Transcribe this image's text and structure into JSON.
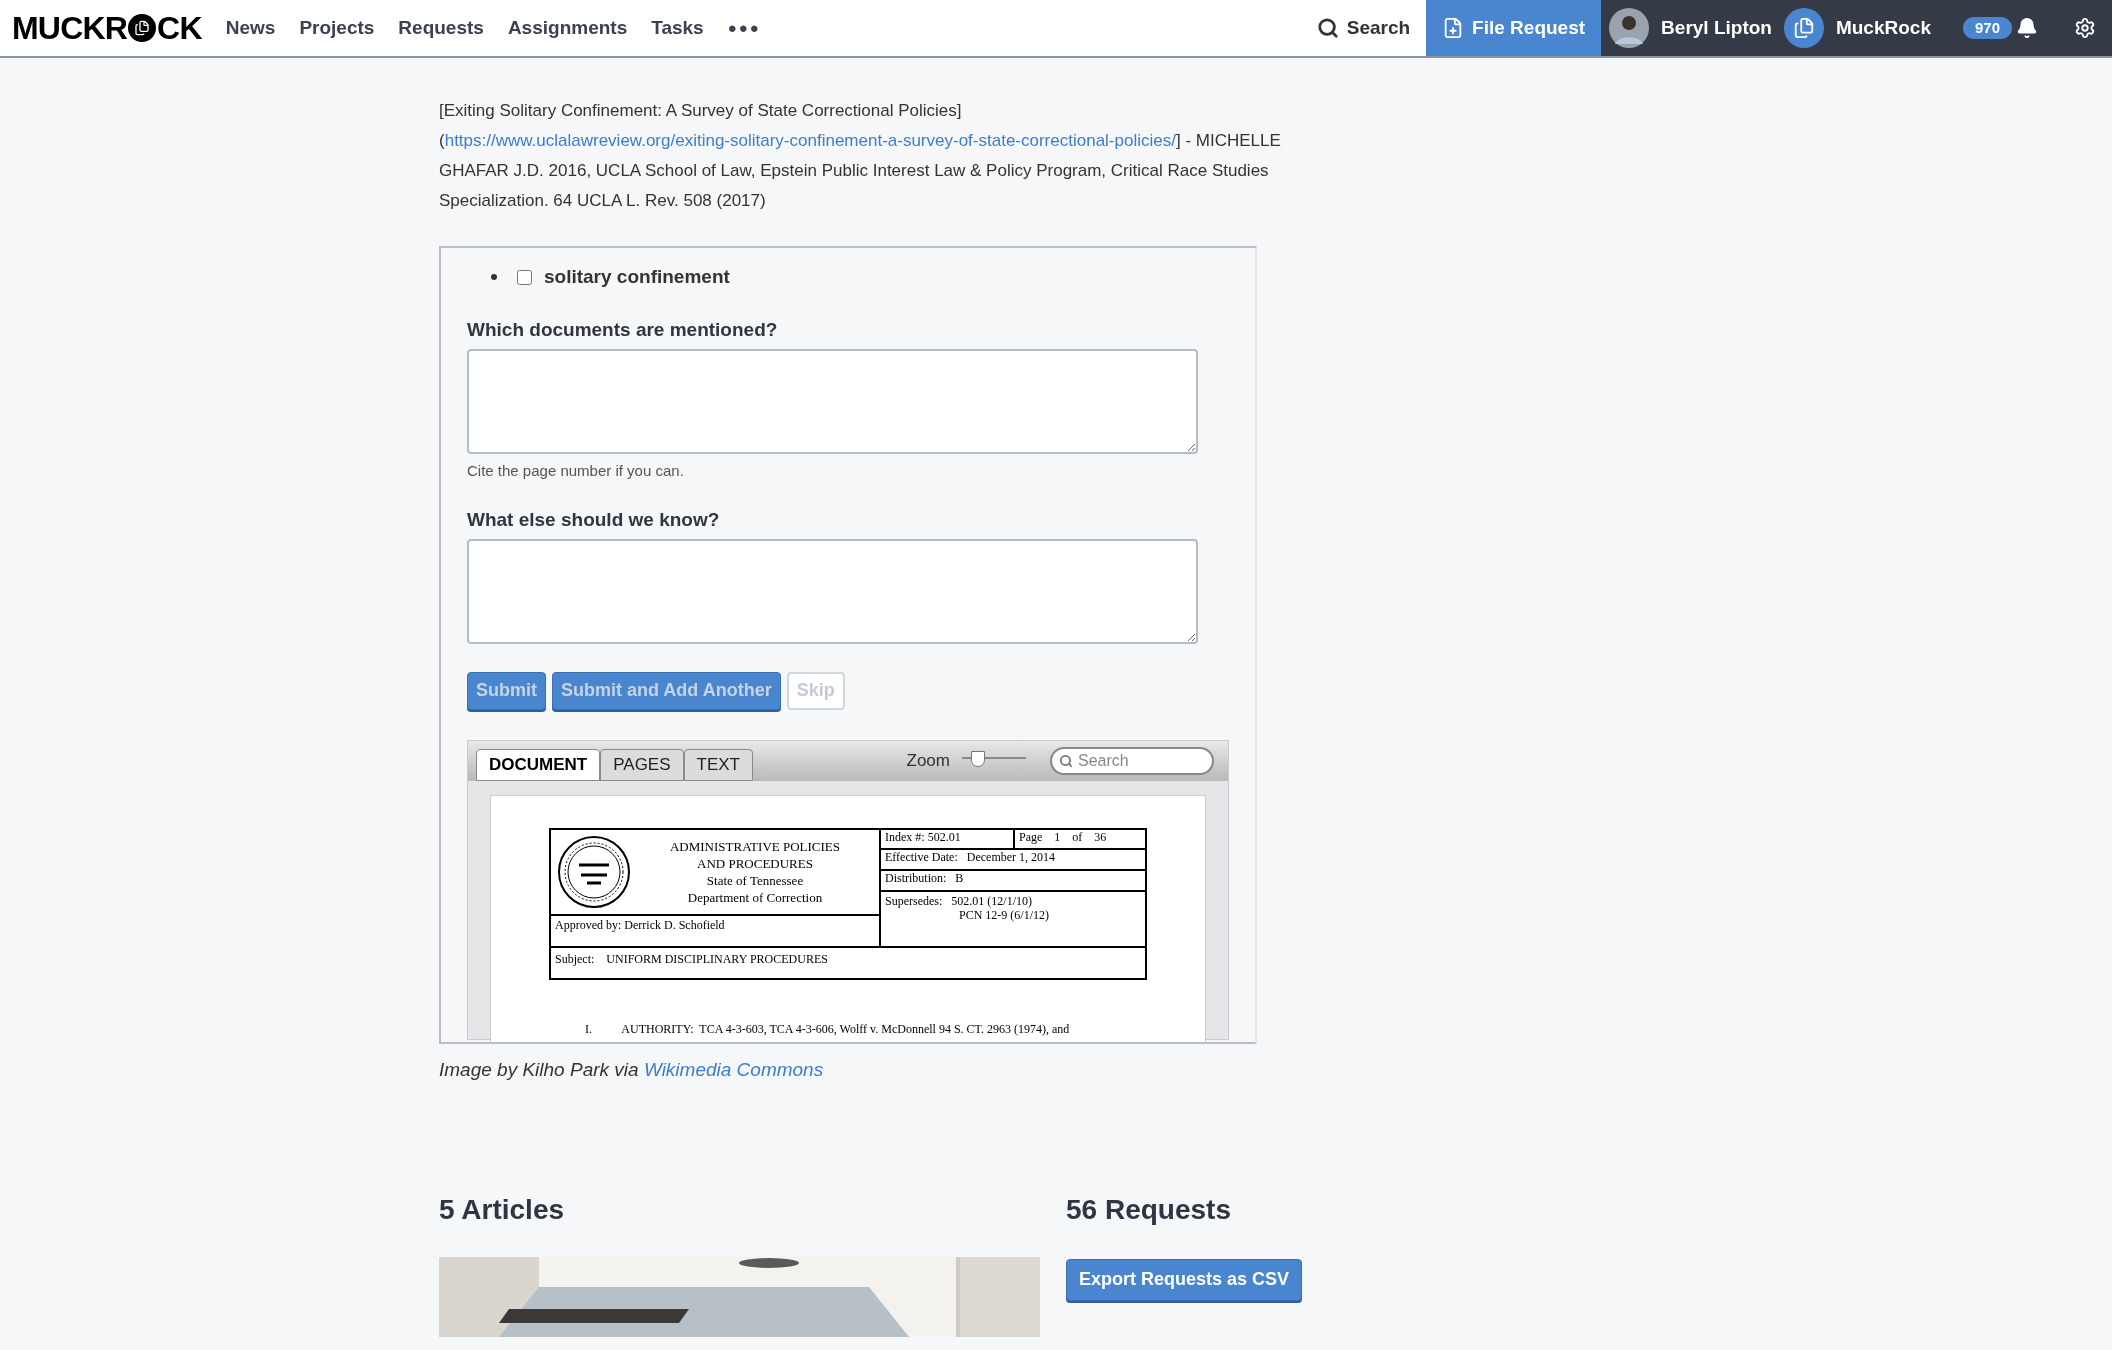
{
  "nav": {
    "logo_before": "MUCKR",
    "logo_after": "CK",
    "links": [
      "News",
      "Projects",
      "Requests",
      "Assignments",
      "Tasks"
    ],
    "more": "●●●",
    "search": "Search",
    "file_request": "File Request",
    "user": "Beryl Lipton",
    "org": "MuckRock",
    "notifications": "970"
  },
  "citation": {
    "before": "[Exiting Solitary Confinement: A Survey of State Correctional Policies](",
    "link": "https://www.uclalawreview.org/exiting-solitary-confinement-a-survey-of-state-correctional-policies/",
    "after": "] - MICHELLE GHAFAR J.D. 2016, UCLA School of Law, Epstein Public Interest Law & Policy Program, Critical Race Studies Specialization. 64 UCLA L. Rev. 508 (2017)"
  },
  "form": {
    "options": [
      {
        "label": "solitary confinement",
        "checked": false
      }
    ],
    "fields": [
      {
        "label": "Which documents are mentioned?",
        "help": "Cite the page number if you can."
      },
      {
        "label": "What else should we know?"
      }
    ],
    "buttons": [
      {
        "label": "Submit",
        "kind": "primary",
        "disabled": true
      },
      {
        "label": "Submit and Add Another",
        "kind": "primary",
        "disabled": true
      },
      {
        "label": "Skip",
        "kind": "plain",
        "disabled": true
      }
    ]
  },
  "viewer": {
    "tabs": [
      {
        "label": "DOCUMENT",
        "selected": true
      },
      {
        "label": "PAGES",
        "selected": false
      },
      {
        "label": "TEXT",
        "selected": false
      }
    ],
    "zoom_label": "Zoom",
    "zoom": {
      "level": 0.25
    },
    "search": {
      "placeholder": "Search"
    },
    "document": {
      "title_lines": [
        "ADMINISTRATIVE POLICIES",
        "AND PROCEDURES",
        "State of Tennessee",
        "Department of Correction"
      ],
      "index": "Index #: 502.01",
      "page": "Page    1    of    36",
      "effective": "Effective Date:   December 1, 2014",
      "distribution": "Distribution:   B",
      "supersedes": "Supersedes:   502.01 (12/1/10)",
      "supersedes_2": "PCN 12-9 (6/1/12)",
      "approved": "Approved by:   Derrick D. Schofield",
      "subject": "Subject:    UNIFORM DISCIPLINARY PROCEDURES",
      "first_line": "I.          AUTHORITY:  TCA 4-3-603, TCA 4-3-606, Wolff v. McDonnell 94 S. CT. 2963 (1974), and"
    }
  },
  "caption": {
    "text": "Image by Kilho Park via ",
    "link": "Wikimedia Commons"
  },
  "articles": {
    "heading": "5 Articles"
  },
  "requests": {
    "heading": "56 Requests",
    "export": "Export Requests as CSV"
  }
}
